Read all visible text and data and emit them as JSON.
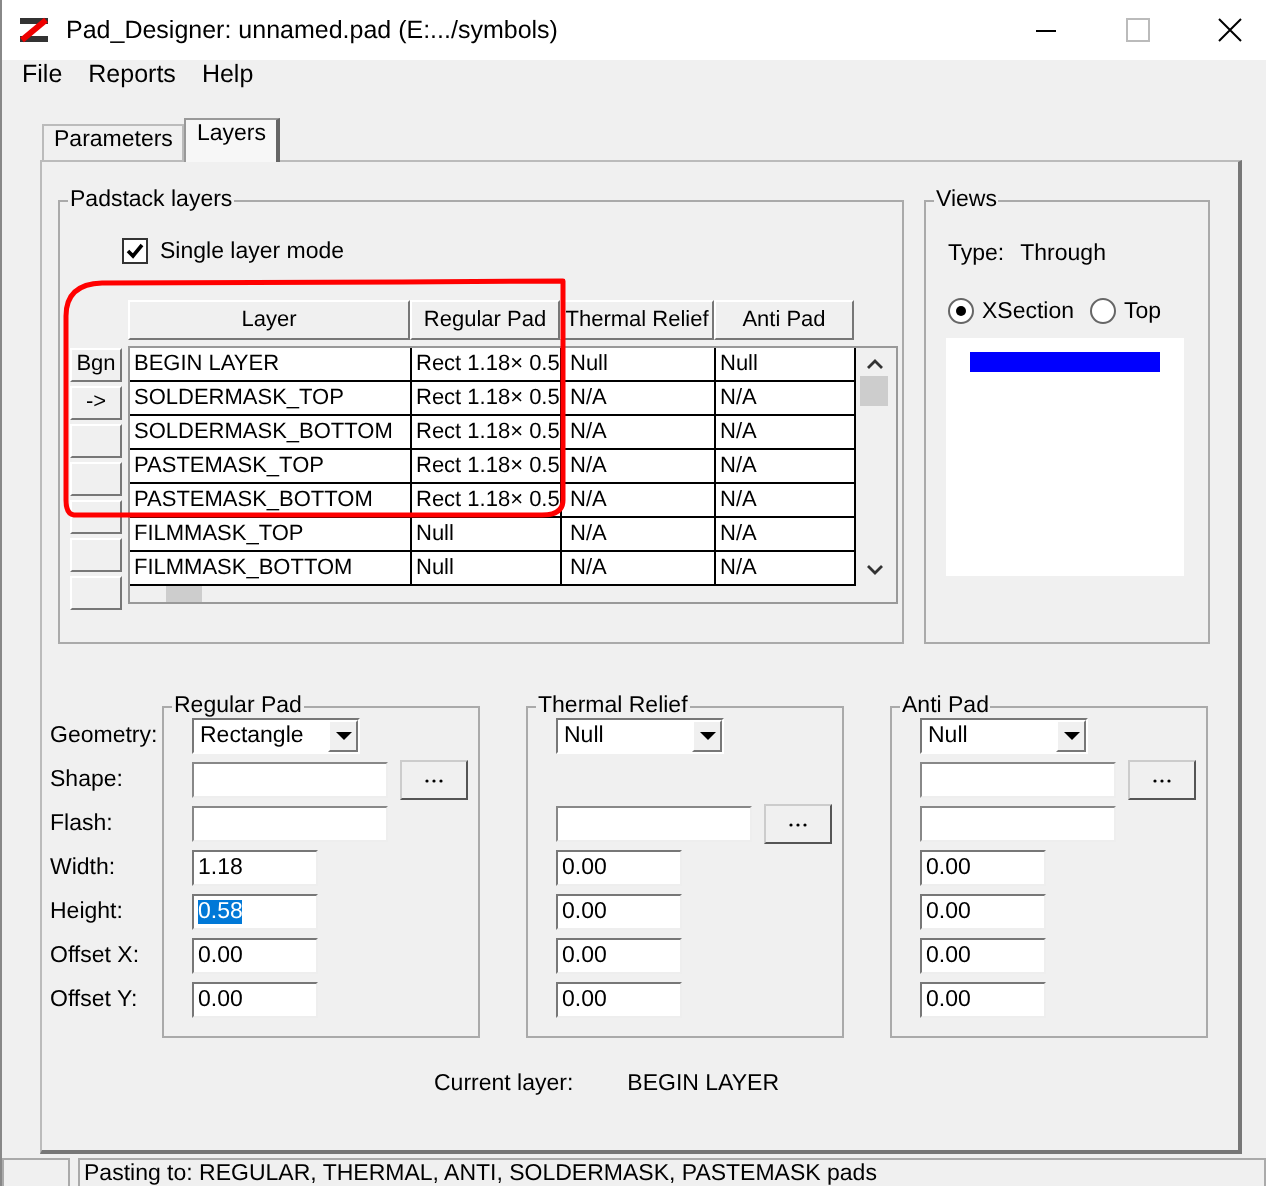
{
  "window": {
    "title": "Pad_Designer: unnamed.pad  (E:.../symbols)"
  },
  "menu": [
    "File",
    "Reports",
    "Help"
  ],
  "tabs": [
    {
      "label": "Parameters",
      "selected": false
    },
    {
      "label": "Layers",
      "selected": true
    }
  ],
  "padstack_layers": {
    "title": "Padstack layers",
    "single_layer_mode": {
      "label": "Single layer mode",
      "checked": true
    },
    "columns": [
      "Layer",
      "Regular Pad",
      "Thermal Relief",
      "Anti Pad"
    ],
    "rows": [
      {
        "marker": "Bgn",
        "cells": [
          "BEGIN LAYER",
          "Rect 1.18× 0.5",
          "Null",
          "Null"
        ]
      },
      {
        "marker": "->",
        "cells": [
          "SOLDERMASK_TOP",
          "Rect 1.18× 0.5",
          "N/A",
          "N/A"
        ]
      },
      {
        "cells": [
          "SOLDERMASK_BOTTOM",
          "Rect 1.18× 0.5",
          "N/A",
          "N/A"
        ]
      },
      {
        "cells": [
          "PASTEMASK_TOP",
          "Rect 1.18× 0.5",
          "N/A",
          "N/A"
        ]
      },
      {
        "cells": [
          "PASTEMASK_BOTTOM",
          "Rect 1.18× 0.5",
          "N/A",
          "N/A"
        ]
      },
      {
        "cells": [
          "FILMMASK_TOP",
          "Null",
          "N/A",
          "N/A"
        ]
      },
      {
        "cells": [
          "FILMMASK_BOTTOM",
          "Null",
          "N/A",
          "N/A"
        ]
      }
    ]
  },
  "views": {
    "title": "Views",
    "type_label": "Type:",
    "type_value": "Through",
    "radios": [
      {
        "label": "XSection",
        "selected": true
      },
      {
        "label": "Top",
        "selected": false
      }
    ]
  },
  "field_labels": [
    "Geometry:",
    "Shape:",
    "Flash:",
    "Width:",
    "Height:",
    "Offset X:",
    "Offset Y:"
  ],
  "pad_groups": [
    {
      "title": "Regular Pad",
      "rows": [
        {
          "kind": "dropdown",
          "value": "Rectangle"
        },
        {
          "kind": "text",
          "browse": true
        },
        {
          "kind": "text",
          "browse": false
        },
        {
          "kind": "number",
          "value": "1.18",
          "highlighted": false
        },
        {
          "kind": "number",
          "value": "0.58",
          "highlighted": true
        },
        {
          "kind": "number",
          "value": "0.00",
          "highlighted": false
        },
        {
          "kind": "number",
          "value": "0.00",
          "highlighted": false
        }
      ]
    },
    {
      "title": "Thermal Relief",
      "rows": [
        {
          "kind": "dropdown",
          "value": "Null"
        },
        {
          "kind": "blank"
        },
        {
          "kind": "text",
          "browse": true
        },
        {
          "kind": "number",
          "value": "0.00",
          "highlighted": false
        },
        {
          "kind": "number",
          "value": "0.00",
          "highlighted": false
        },
        {
          "kind": "number",
          "value": "0.00",
          "highlighted": false
        },
        {
          "kind": "number",
          "value": "0.00",
          "highlighted": false
        }
      ]
    },
    {
      "title": "Anti Pad",
      "rows": [
        {
          "kind": "dropdown",
          "value": "Null"
        },
        {
          "kind": "text",
          "browse": true
        },
        {
          "kind": "text",
          "browse": false
        },
        {
          "kind": "number",
          "value": "0.00",
          "highlighted": false
        },
        {
          "kind": "number",
          "value": "0.00",
          "highlighted": false
        },
        {
          "kind": "number",
          "value": "0.00",
          "highlighted": false
        },
        {
          "kind": "number",
          "value": "0.00",
          "highlighted": false
        }
      ]
    }
  ],
  "current_layer": {
    "label": "Current layer:",
    "value": "BEGIN LAYER"
  },
  "status_bar": {
    "text": "Pasting to: REGULAR, THERMAL, ANTI, SOLDERMASK, PASTEMASK  pads"
  }
}
